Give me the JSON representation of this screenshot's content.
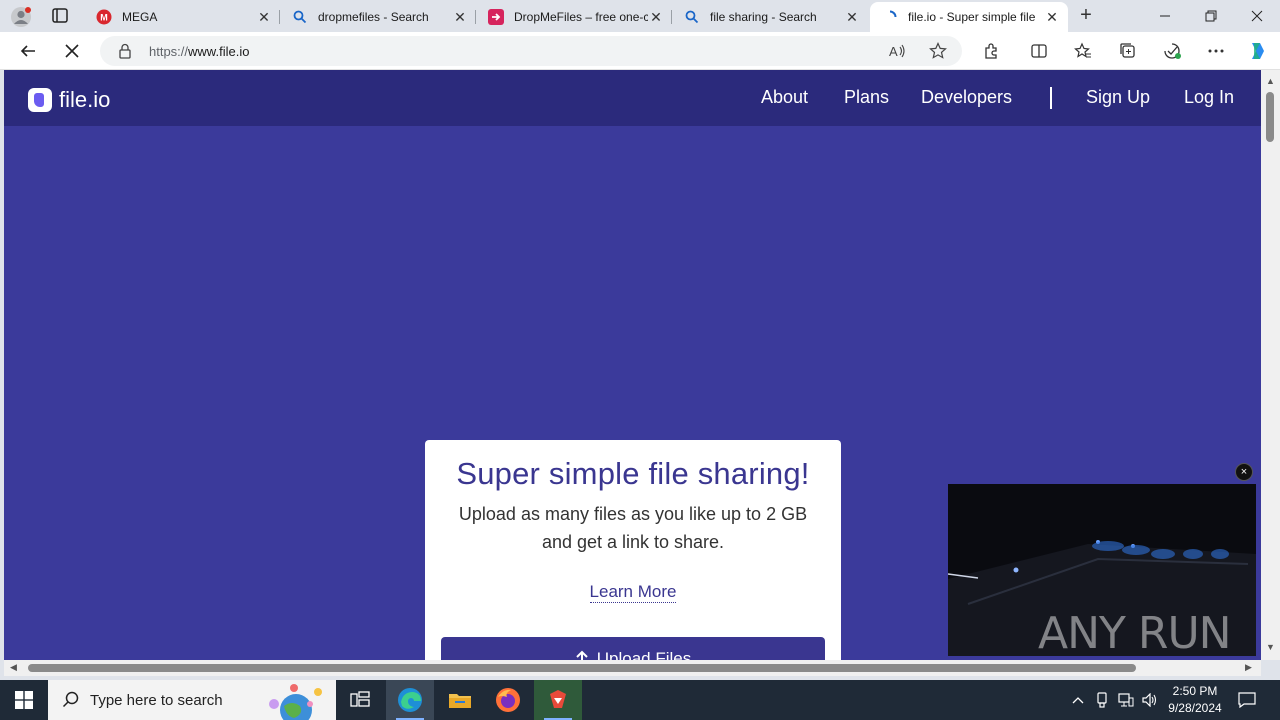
{
  "browser": {
    "tabs": [
      {
        "title": "MEGA",
        "favicon": "mega-icon",
        "active": false
      },
      {
        "title": "dropmefiles - Search",
        "favicon": "search-icon",
        "active": false
      },
      {
        "title": "DropMeFiles – free one-c",
        "favicon": "dropmefiles-icon",
        "active": false
      },
      {
        "title": "file sharing - Search",
        "favicon": "search-icon",
        "active": false
      },
      {
        "title": "file.io - Super simple file",
        "favicon": "fileio-icon",
        "active": true
      }
    ],
    "new_tab": "+",
    "address": {
      "prefix": "https://",
      "host": "www.file.io"
    }
  },
  "site": {
    "logo_text": "file.io",
    "nav": {
      "about": "About",
      "plans": "Plans",
      "developers": "Developers",
      "sign_up": "Sign Up",
      "log_in": "Log In"
    },
    "hero": {
      "title": "Super simple file sharing!",
      "subtitle": "Upload as many files as you like up to 2 GB and get a link to share.",
      "learn_more": "Learn More",
      "upload_button": "Upload Files"
    }
  },
  "overlay": {
    "close": "×",
    "watermark": "ANY RUN"
  },
  "taskbar": {
    "search_placeholder": "Type here to search",
    "time": "2:50 PM",
    "date": "9/28/2024"
  },
  "colors": {
    "page_bg": "#3b3a9b",
    "nav_bg": "#2b2a7c",
    "accent": "#3a3690",
    "taskbar": "#1f2a37"
  }
}
